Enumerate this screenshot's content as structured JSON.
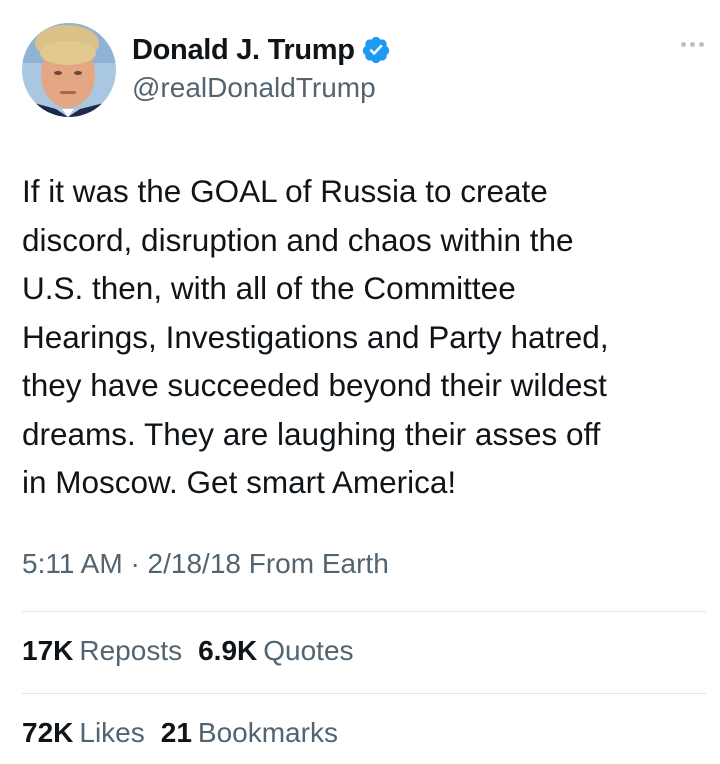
{
  "author": {
    "display_name": "Donald J. Trump",
    "handle": "@realDonaldTrump",
    "verified_icon": "verified-badge-icon",
    "verified_color": "#1d9bf0"
  },
  "tweet": {
    "text": "If it was the GOAL of Russia to create\ndiscord, disruption and chaos within the\nU.S. then, with all of the Committee\nHearings, Investigations and Party hatred,\nthey have succeeded beyond their wildest\ndreams. They are laughing their asses off\nin Moscow. Get smart America!",
    "time": "5:11 AM",
    "separator": "·",
    "date": "2/18/18",
    "source": "From Earth"
  },
  "stats": {
    "reposts": {
      "count": "17K",
      "label": "Reposts"
    },
    "quotes": {
      "count": "6.9K",
      "label": "Quotes"
    },
    "likes": {
      "count": "72K",
      "label": "Likes"
    },
    "bookmarks": {
      "count": "21",
      "label": "Bookmarks"
    }
  },
  "icons": {
    "more": "more-options-icon"
  }
}
